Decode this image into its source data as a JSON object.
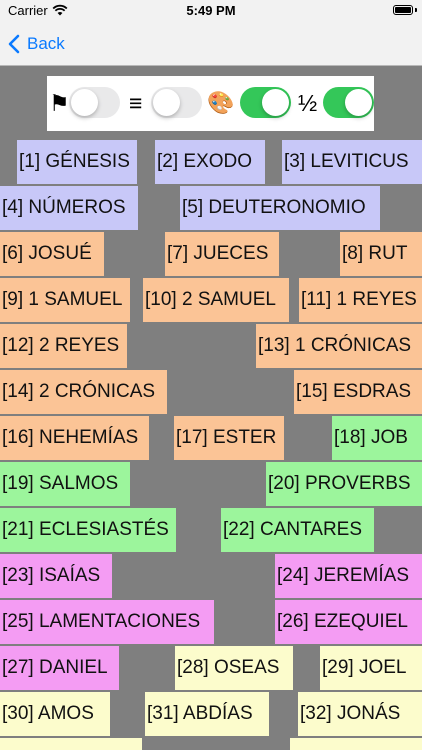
{
  "status_bar": {
    "carrier": "Carrier",
    "time": "5:49 PM"
  },
  "nav": {
    "back_label": "Back"
  },
  "controls": {
    "flag_icon": "⚑",
    "list_icon": "≡",
    "palette_icon": "🎨",
    "half_icon": "½",
    "toggles": {
      "flag": false,
      "list": false,
      "palette": true,
      "half": true
    }
  },
  "colors": {
    "purple": "#c8c8f8",
    "orange": "#fbc496",
    "green": "#9cf59c",
    "pink": "#f49cf3",
    "yellow": "#fcfccc",
    "toggle_on": "#34c759",
    "background": "#7f7f7f"
  },
  "books": [
    "[1] GÉNESIS",
    "[2] EXODO",
    "[3] LEVITICUS",
    "[4] NÚMEROS",
    "[5] DEUTERONOMIO",
    "[6] JOSUÉ",
    "[7] JUECES",
    "[8] RUT",
    "[9] 1 SAMUEL",
    "[10] 2 SAMUEL",
    "[11] 1 REYES",
    "[12] 2 REYES",
    "[13] 1 CRÓNICAS",
    "[14] 2 CRÓNICAS",
    "[15] ESDRAS",
    "[16] NEHEMÍAS",
    "[17] ESTER",
    "[18] JOB",
    "[19] SALMOS",
    "[20] PROVERBS",
    "[21] ECLESIASTÉS",
    "[22] CANTARES",
    "[23] ISAÍAS",
    "[24] JEREMÍAS",
    "[25] LAMENTACIONES",
    "[26] EZEQUIEL",
    "[27] DANIEL",
    "[28] OSEAS",
    "[29] JOEL",
    "[30] AMOS",
    "[31] ABDÍAS",
    "[32] JONÁS"
  ]
}
